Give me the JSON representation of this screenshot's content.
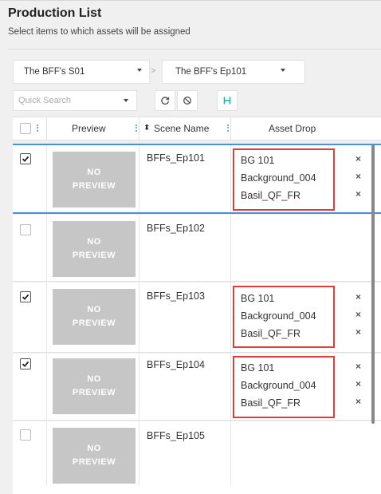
{
  "header": {
    "title": "Production List",
    "subtitle": "Select items to which assets will be assigned"
  },
  "filters": {
    "season": "The BFF's S01",
    "episode": "The BFF's Ep101",
    "separator": ">",
    "quick_search_placeholder": "Quick Search"
  },
  "toolbar": {
    "refresh_icon": "refresh-icon",
    "clear_icon": "clear-icon",
    "hierarchy_icon": "hierarchy-icon",
    "accent": "#20b2aa"
  },
  "table": {
    "columns": [
      "Preview",
      "Scene Name",
      "Asset Drop"
    ],
    "sort_indicator": "⬍",
    "rows": [
      {
        "checked": true,
        "preview": [
          "NO",
          "PREVIEW"
        ],
        "scene": "BFFs_Ep101",
        "assets": [
          "BG 101",
          "Background_004",
          "Basil_QF_FR"
        ],
        "selected": true
      },
      {
        "checked": false,
        "preview": [
          "NO",
          "PREVIEW"
        ],
        "scene": "BFFs_Ep102",
        "assets": [],
        "selected": false
      },
      {
        "checked": true,
        "preview": [
          "NO",
          "PREVIEW"
        ],
        "scene": "BFFs_Ep103",
        "assets": [
          "BG 101",
          "Background_004",
          "Basil_QF_FR"
        ],
        "selected": false
      },
      {
        "checked": true,
        "preview": [
          "NO",
          "PREVIEW"
        ],
        "scene": "BFFs_Ep104",
        "assets": [
          "BG 101",
          "Background_004",
          "Basil_QF_FR"
        ],
        "selected": false
      },
      {
        "checked": false,
        "preview": [
          "NO",
          "PREVIEW"
        ],
        "scene": "BFFs_Ep105",
        "assets": [],
        "selected": false
      }
    ],
    "remove_glyph": "×"
  },
  "colors": {
    "highlight_border": "#e03c3c",
    "selection_border": "#4a90d9",
    "preview_bg": "#c6c6c6"
  }
}
